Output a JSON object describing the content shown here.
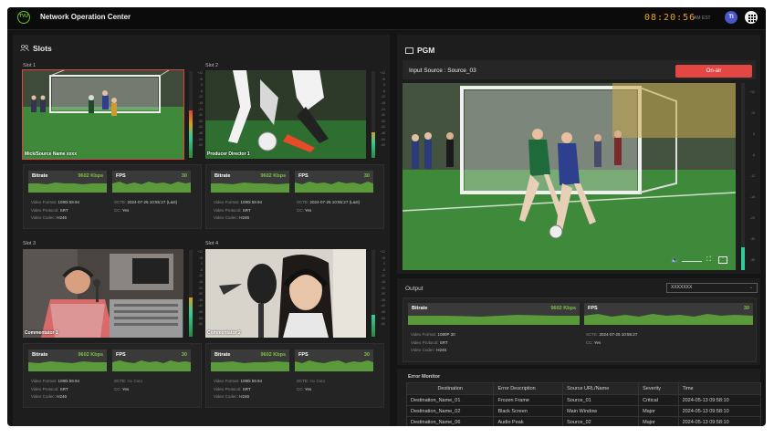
{
  "app": {
    "title": "Network Operation Center",
    "logo_text": "TVU"
  },
  "header": {
    "clock": "08:20:56",
    "clock_zone": "AM EST",
    "avatar_initials": "TI"
  },
  "slots_section": {
    "title": "Slots"
  },
  "vu_scale": [
    "+12",
    "+6",
    "0",
    "-6",
    "-12",
    "-18",
    "-24",
    "-30",
    "-36",
    "-42",
    "-48",
    "-54",
    "-60"
  ],
  "slots": [
    {
      "label": "Slot 1",
      "caption": "Mick/Source Name xxxx",
      "selected": true,
      "bitrate_label": "Bitrate",
      "bitrate": "9602 Kbps",
      "fps_label": "FPS",
      "fps": "30",
      "format_label": "Video Format:",
      "format": "1080i 59.94",
      "protocol_label": "Video Protocol:",
      "protocol": "SRT",
      "codec_label": "Video Codec:",
      "codec": "H246",
      "scte_label": "SCTE:",
      "scte": "2024-07-25 10:55:27 (Last)",
      "scte_na": false,
      "cc_label": "CC:",
      "cc": "Yes",
      "vu_level": 0.55
    },
    {
      "label": "Slot 2",
      "caption": "Producer Director 1",
      "selected": false,
      "bitrate_label": "Bitrate",
      "bitrate": "9602 Kbps",
      "fps_label": "FPS",
      "fps": "30",
      "format_label": "Video Format:",
      "format": "1080i 59.94",
      "protocol_label": "Video Protocol:",
      "protocol": "SRT",
      "codec_label": "Video Codec:",
      "codec": "H246",
      "scte_label": "SCTE:",
      "scte": "2024-07-25 10:55:27 (Last)",
      "scte_na": false,
      "cc_label": "CC:",
      "cc": "Yes",
      "vu_level": 0.3
    },
    {
      "label": "Slot 3",
      "caption": "Commentator 1",
      "selected": false,
      "bitrate_label": "Bitrate",
      "bitrate": "9602 Kbps",
      "fps_label": "FPS",
      "fps": "30",
      "format_label": "Video Format:",
      "format": "1080i 59.94",
      "protocol_label": "Video Protocol:",
      "protocol": "SRT",
      "codec_label": "Video Codec:",
      "codec": "H246",
      "scte_label": "SCTE:",
      "scte": "No Data",
      "scte_na": true,
      "cc_label": "CC:",
      "cc": "Yes",
      "vu_level": 0.45
    },
    {
      "label": "Slot 4",
      "caption": "Commentator 2",
      "selected": false,
      "bitrate_label": "Bitrate",
      "bitrate": "9602 Kbps",
      "fps_label": "FPS",
      "fps": "30",
      "format_label": "Video Format:",
      "format": "1080i 59.94",
      "protocol_label": "Video Protocol:",
      "protocol": "SRT",
      "codec_label": "Video Codec:",
      "codec": "H246",
      "scte_label": "SCTE:",
      "scte": "No Data",
      "scte_na": true,
      "cc_label": "CC:",
      "cc": "Yes",
      "vu_level": 0.25
    }
  ],
  "pgm": {
    "title": "PGM",
    "input_source": "Input Source : Source_03",
    "onair_label": "On-air",
    "vu_scale": [
      "+12",
      "+6",
      "0",
      "-6",
      "-12",
      "-18",
      "-24",
      "-30",
      "-36"
    ],
    "vu_level": 0.12
  },
  "output": {
    "title": "Output",
    "dropdown_value": "XXXXXXX",
    "bitrate_label": "Bitrate",
    "bitrate": "9602 Kbps",
    "fps_label": "FPS",
    "fps": "30",
    "format_label": "Video Format:",
    "format": "1080P 30",
    "protocol_label": "Video Protocol:",
    "protocol": "SRT",
    "codec_label": "Video Codec:",
    "codec": "H246",
    "scte_label": "SCTE:",
    "scte": "2024-07-25 10:55:27",
    "cc_label": "CC:",
    "cc": "Yes"
  },
  "error_monitor": {
    "title": "Error Monitor",
    "columns": [
      "Destination",
      "Error Description",
      "Source URL/Name",
      "Severity",
      "Time"
    ],
    "rows": [
      {
        "destination": "Destination_Name_01",
        "error": "Frozen Frame",
        "source": "Source_01",
        "severity": "Critical",
        "time": "2024-05-13 09:58:10"
      },
      {
        "destination": "Destination_Name_02",
        "error": "Black Screen",
        "source": "Main Window",
        "severity": "Major",
        "time": "2024-05-13 09:58:10"
      },
      {
        "destination": "Destination_Name_06",
        "error": "Audio Peak",
        "source": "Source_02",
        "severity": "Major",
        "time": "2024-05-13 09:58:10"
      }
    ]
  },
  "colors": {
    "accent_green": "#7cc242",
    "onair_red": "#e34743",
    "clock_orange": "#f0a020",
    "critical": "#e34743",
    "major": "#f0a020"
  }
}
